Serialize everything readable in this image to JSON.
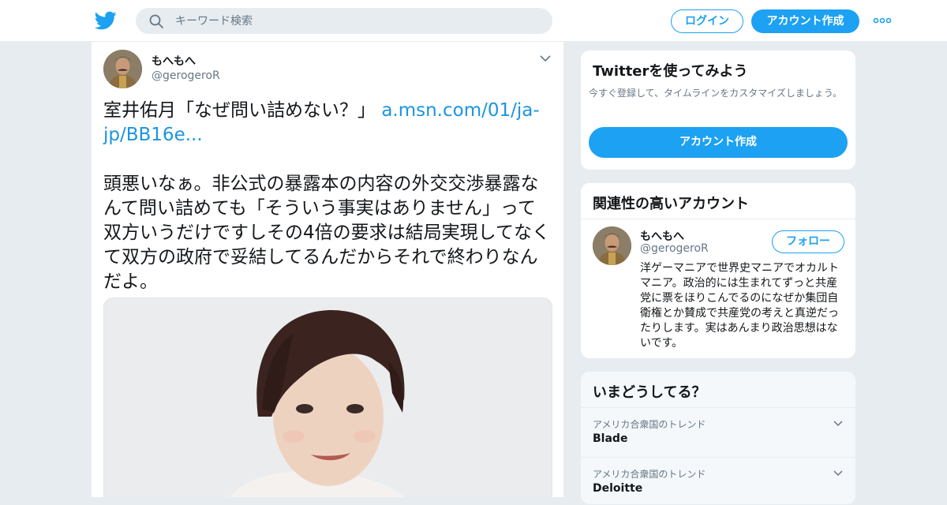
{
  "nav": {
    "search_placeholder": "キーワード検索",
    "login_label": "ログイン",
    "signup_label": "アカウント作成",
    "logo_icon": "twitter-bird-icon",
    "more_icon": "more-dots-icon"
  },
  "tweet": {
    "name": "もへもへ",
    "handle": "@gerogeroR",
    "text_before_link": "室井佑月「なぜ問い詰めない？」 ",
    "link": "a.msn.com/01/ja-jp/BB16e...",
    "body": "頭悪いなぁ。非公式の暴露本の内容の外交交渉暴露なんて問い詰めても「そういう事実はありません」って双方いうだけですしその4倍の要求は結局実現してなくて双方の政府で妥結してるんだからそれで終わりなんだよ。"
  },
  "signup_card": {
    "title": "Twitterを使ってみよう",
    "subtitle": "今すぐ登録して、タイムラインをカスタマイズしましょう。",
    "button_label": "アカウント作成"
  },
  "related_card": {
    "title": "関連性の高いアカウント",
    "name": "もへもへ",
    "handle": "@gerogeroR",
    "follow_label": "フォロー",
    "bio": "洋ゲーマニアで世界史マニアでオカルトマニア。政治的には生まれてずっと共産党に票をほりこんでるのになぜか集団自衛権とか賛成で共産党の考えと真逆だったりします。実はあんまり政治思想はないです。"
  },
  "trends_card": {
    "title": "いまどうしてる？",
    "items": [
      {
        "context": "アメリカ合衆国のトレンド",
        "name": "Blade"
      },
      {
        "context": "アメリカ合衆国のトレンド",
        "name": "Deloitte"
      }
    ]
  },
  "colors": {
    "accent": "#1da1f2",
    "link": "#1b95e0",
    "background": "#e6ecf0",
    "muted_text": "#657786"
  }
}
